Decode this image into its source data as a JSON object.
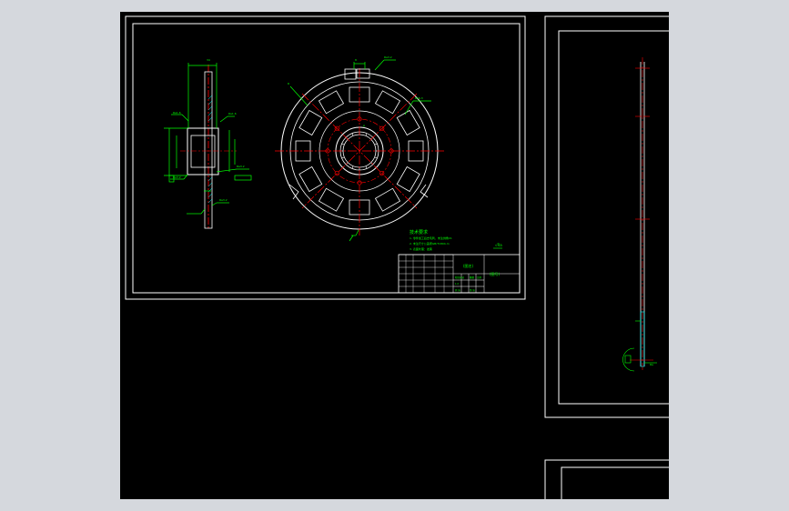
{
  "viewport": {
    "background": "#000000",
    "colors": {
      "border": "#ffffff",
      "geometry": "#ffffff",
      "dimension": "#00ff00",
      "centerline": "#ff0000",
      "bolt_holes": "#ff0000"
    }
  },
  "annotations": {
    "sheet_label": "(图名)",
    "tech_req_title": "技术要求",
    "tech_req_lines": [
      "1. 零件加工后去毛刺，未注倒角C1",
      "2. 未注尺寸公差按GB/T1804-m",
      "3. 表面处理：发黑"
    ],
    "roughness": "√Ra",
    "title_block_name": "(图号)",
    "title_block_company": "(单位名称)"
  }
}
